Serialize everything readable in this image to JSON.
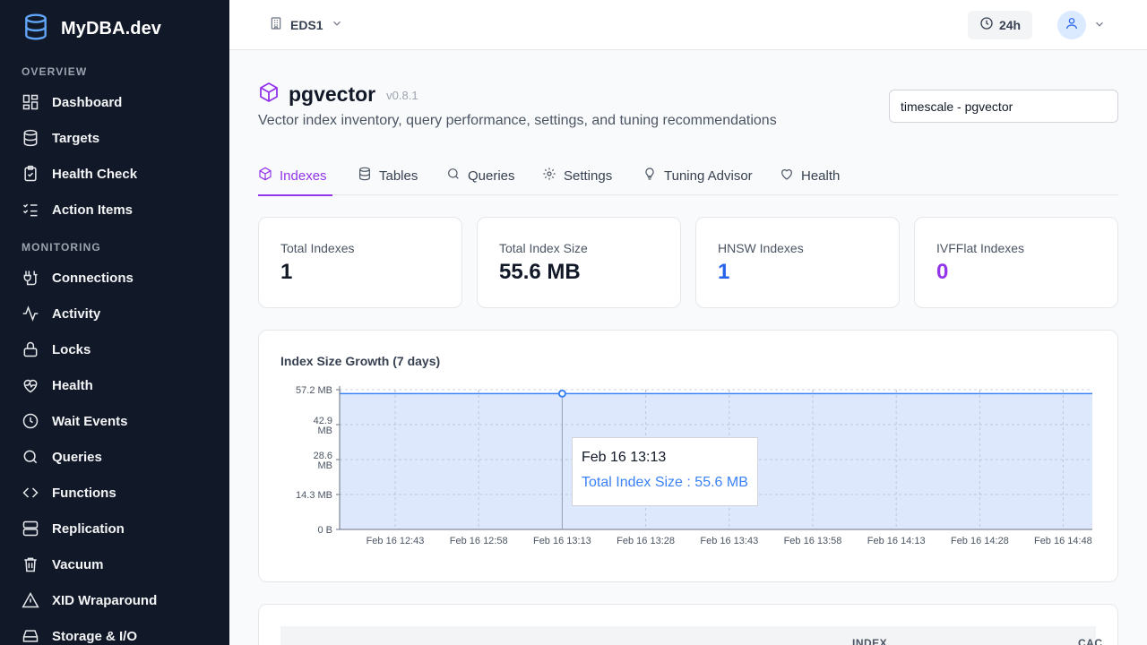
{
  "app": {
    "name": "MyDBA.dev"
  },
  "sidebar": {
    "sections": [
      {
        "title": "OVERVIEW",
        "items": [
          {
            "label": "Dashboard",
            "icon": "dashboard-icon"
          },
          {
            "label": "Targets",
            "icon": "database-icon"
          },
          {
            "label": "Health Check",
            "icon": "clipboard-check-icon"
          },
          {
            "label": "Action Items",
            "icon": "list-checks-icon"
          }
        ]
      },
      {
        "title": "MONITORING",
        "items": [
          {
            "label": "Connections",
            "icon": "plug-icon"
          },
          {
            "label": "Activity",
            "icon": "activity-icon"
          },
          {
            "label": "Locks",
            "icon": "lock-icon"
          },
          {
            "label": "Health",
            "icon": "heart-pulse-icon"
          },
          {
            "label": "Wait Events",
            "icon": "clock-icon"
          },
          {
            "label": "Queries",
            "icon": "search-icon"
          },
          {
            "label": "Functions",
            "icon": "code-icon"
          },
          {
            "label": "Replication",
            "icon": "server-icon"
          },
          {
            "label": "Vacuum",
            "icon": "trash-icon"
          },
          {
            "label": "XID Wraparound",
            "icon": "warning-icon"
          },
          {
            "label": "Storage & I/O",
            "icon": "hard-drive-icon"
          }
        ]
      }
    ]
  },
  "topbar": {
    "environment": "EDS1",
    "time_range": "24h"
  },
  "header": {
    "title": "pgvector",
    "version": "v0.8.1",
    "subtitle": "Vector index inventory, query performance, settings, and tuning recommendations",
    "database_select": "timescale - pgvector"
  },
  "tabs": [
    {
      "label": "Indexes",
      "icon": "box-icon",
      "active": true
    },
    {
      "label": "Tables",
      "icon": "database-icon",
      "active": false
    },
    {
      "label": "Queries",
      "icon": "search-icon",
      "active": false
    },
    {
      "label": "Settings",
      "icon": "gear-icon",
      "active": false
    },
    {
      "label": "Tuning Advisor",
      "icon": "lightbulb-icon",
      "active": false
    },
    {
      "label": "Health",
      "icon": "heart-icon",
      "active": false
    }
  ],
  "stats": [
    {
      "label": "Total Indexes",
      "value": "1",
      "color": "#111827"
    },
    {
      "label": "Total Index Size",
      "value": "55.6 MB",
      "color": "#111827"
    },
    {
      "label": "HNSW Indexes",
      "value": "1",
      "color": "#2563eb"
    },
    {
      "label": "IVFFlat Indexes",
      "value": "0",
      "color": "#9333ea"
    }
  ],
  "chart_data": {
    "type": "area",
    "title": "Index Size Growth (7 days)",
    "x": [
      "Feb 16 12:43",
      "Feb 16 12:58",
      "Feb 16 13:13",
      "Feb 16 13:28",
      "Feb 16 13:43",
      "Feb 16 13:58",
      "Feb 16 14:13",
      "Feb 16 14:28",
      "Feb 16 14:48"
    ],
    "series": [
      {
        "name": "Total Index Size",
        "values": [
          55.6,
          55.6,
          55.6,
          55.6,
          55.6,
          55.6,
          55.6,
          55.6,
          55.6
        ]
      }
    ],
    "yticks": [
      "0 B",
      "14.3 MB",
      "28.6 MB",
      "42.9 MB",
      "57.2 MB"
    ],
    "ylim": [
      0,
      57.2
    ],
    "grid": true,
    "tooltip": {
      "x": "Feb 16 13:13",
      "text": "Total Index Size : 55.6 MB"
    },
    "colors": {
      "line": "#3b82f6",
      "fill": "#dbe7fd"
    }
  },
  "table": {
    "headers": [
      "INDEX",
      "CAC"
    ]
  }
}
